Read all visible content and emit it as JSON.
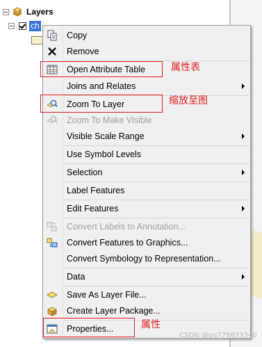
{
  "toc": {
    "root_label": "Layers",
    "layer_name": "ch"
  },
  "menu": {
    "items": [
      {
        "label": "Copy",
        "icon": "copy-icon",
        "enabled": true
      },
      {
        "label": "Remove",
        "icon": "remove-icon",
        "enabled": true
      },
      {
        "label": "Open Attribute Table",
        "icon": "table-icon",
        "enabled": true
      },
      {
        "label": "Joins and Relates",
        "icon": "",
        "enabled": true,
        "submenu": true
      },
      {
        "label": "Zoom To Layer",
        "icon": "zoom-to-layer-icon",
        "enabled": true
      },
      {
        "label": "Zoom To Make Visible",
        "icon": "zoom-visible-icon",
        "enabled": false
      },
      {
        "label": "Visible Scale Range",
        "icon": "",
        "enabled": true,
        "submenu": true
      },
      {
        "label": "Use Symbol Levels",
        "icon": "",
        "enabled": true
      },
      {
        "label": "Selection",
        "icon": "",
        "enabled": true,
        "submenu": true
      },
      {
        "label": "Label Features",
        "icon": "",
        "enabled": true
      },
      {
        "label": "Edit Features",
        "icon": "",
        "enabled": true,
        "submenu": true
      },
      {
        "label": "Convert Labels to Annotation...",
        "icon": "convert-labels-icon",
        "enabled": false
      },
      {
        "label": "Convert Features to Graphics...",
        "icon": "convert-graphics-icon",
        "enabled": true
      },
      {
        "label": "Convert Symbology to Representation...",
        "icon": "",
        "enabled": true
      },
      {
        "label": "Data",
        "icon": "",
        "enabled": true,
        "submenu": true
      },
      {
        "label": "Save As Layer File...",
        "icon": "layer-file-icon",
        "enabled": true
      },
      {
        "label": "Create Layer Package...",
        "icon": "layer-package-icon",
        "enabled": true
      },
      {
        "label": "Properties...",
        "icon": "properties-icon",
        "enabled": true
      }
    ]
  },
  "annotations": {
    "attribute_table": "属性表",
    "zoom_to_layer": "缩放至图",
    "properties": "属性"
  },
  "watermark": "CSDN @qq779823340",
  "colors": {
    "annotation": "#e02020",
    "selection": "#3875d7"
  }
}
